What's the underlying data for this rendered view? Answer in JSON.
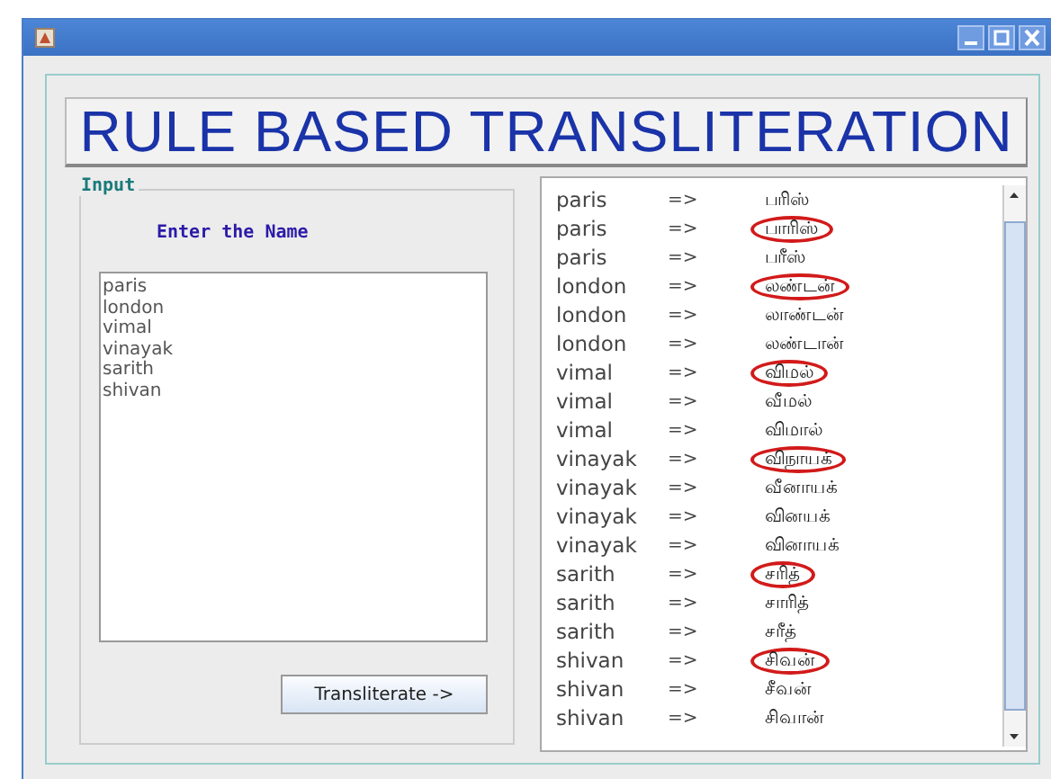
{
  "heading": "RULE BASED TRANSLITERATION",
  "input_panel": {
    "title": "Input",
    "label": "Enter the Name",
    "names": [
      "paris",
      "london",
      "vimal",
      "vinayak",
      "sarith",
      "shivan"
    ],
    "button": "Transliterate ->"
  },
  "results": [
    {
      "name": "paris",
      "arrow": "=>",
      "tamil": "பரிஸ்",
      "circled": false
    },
    {
      "name": "paris",
      "arrow": "=>",
      "tamil": "பாரிஸ்",
      "circled": true
    },
    {
      "name": "paris",
      "arrow": "=>",
      "tamil": "பரீஸ்",
      "circled": false
    },
    {
      "name": "london",
      "arrow": "=>",
      "tamil": "லண்டன்",
      "circled": true
    },
    {
      "name": "london",
      "arrow": "=>",
      "tamil": "லாண்டன்",
      "circled": false
    },
    {
      "name": "london",
      "arrow": "=>",
      "tamil": "லண்டான்",
      "circled": false
    },
    {
      "name": "vimal",
      "arrow": "=>",
      "tamil": "விமல்",
      "circled": true
    },
    {
      "name": "vimal",
      "arrow": "=>",
      "tamil": "வீமல்",
      "circled": false
    },
    {
      "name": "vimal",
      "arrow": "=>",
      "tamil": "விமால்",
      "circled": false
    },
    {
      "name": "vinayak",
      "arrow": "=>",
      "tamil": "விநாயக்",
      "circled": true
    },
    {
      "name": "vinayak",
      "arrow": "=>",
      "tamil": "வீனாயக்",
      "circled": false
    },
    {
      "name": "vinayak",
      "arrow": "=>",
      "tamil": "வினயக்",
      "circled": false
    },
    {
      "name": "vinayak",
      "arrow": "=>",
      "tamil": "வினாயக்",
      "circled": false
    },
    {
      "name": "sarith",
      "arrow": "=>",
      "tamil": "சரித்",
      "circled": true
    },
    {
      "name": "sarith",
      "arrow": "=>",
      "tamil": "சாரித்",
      "circled": false
    },
    {
      "name": "sarith",
      "arrow": "=>",
      "tamil": "சரீத்",
      "circled": false
    },
    {
      "name": "shivan",
      "arrow": "=>",
      "tamil": "சிவன்",
      "circled": true
    },
    {
      "name": "shivan",
      "arrow": "=>",
      "tamil": "சீவன்",
      "circled": false
    },
    {
      "name": "shivan",
      "arrow": "=>",
      "tamil": "சிவான்",
      "circled": false
    }
  ]
}
